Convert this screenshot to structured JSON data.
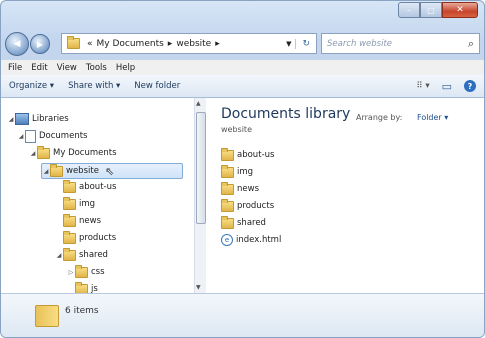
{
  "window": {
    "controls": {
      "minimize": "–",
      "maximize": "□",
      "close": "✕"
    }
  },
  "nav": {
    "back_icon": "◀",
    "forward_icon": "▶",
    "breadcrumb": [
      "«",
      "My Documents",
      "▸",
      "website",
      "▸"
    ],
    "refresh_icon": "↻",
    "search_placeholder": "Search website",
    "search_icon": "⌕"
  },
  "menu": [
    "File",
    "Edit",
    "View",
    "Tools",
    "Help"
  ],
  "commands": {
    "organize": "Organize ▾",
    "share": "Share with ▾",
    "new_folder": "New folder",
    "view_icon": "⠿ ▾",
    "preview_icon": "▭",
    "help_icon": "?"
  },
  "tree": [
    {
      "label": "Libraries",
      "indent": 0,
      "arrow": "◢",
      "icon": "library"
    },
    {
      "label": "Documents",
      "indent": 1,
      "arrow": "◢",
      "icon": "doc"
    },
    {
      "label": "My Documents",
      "indent": 2,
      "arrow": "◢",
      "icon": "folder"
    },
    {
      "label": "website",
      "indent": 3,
      "arrow": "◢",
      "icon": "folder",
      "selected": true
    },
    {
      "label": "about-us",
      "indent": 4,
      "arrow": "",
      "icon": "folder"
    },
    {
      "label": "img",
      "indent": 4,
      "arrow": "",
      "icon": "folder"
    },
    {
      "label": "news",
      "indent": 4,
      "arrow": "",
      "icon": "folder"
    },
    {
      "label": "products",
      "indent": 4,
      "arrow": "",
      "icon": "folder"
    },
    {
      "label": "shared",
      "indent": 4,
      "arrow": "◢",
      "icon": "folder"
    },
    {
      "label": "css",
      "indent": 5,
      "arrow": "▷",
      "icon": "folder"
    },
    {
      "label": "js",
      "indent": 5,
      "arrow": "",
      "icon": "folder"
    }
  ],
  "library": {
    "title": "Documents library",
    "subtitle": "website",
    "arrange_label": "Arrange by:",
    "arrange_value": "Folder ▾"
  },
  "files": [
    {
      "name": "about-us",
      "type": "folder"
    },
    {
      "name": "img",
      "type": "folder"
    },
    {
      "name": "news",
      "type": "folder"
    },
    {
      "name": "products",
      "type": "folder"
    },
    {
      "name": "shared",
      "type": "folder"
    },
    {
      "name": "index.html",
      "type": "html"
    }
  ],
  "status": {
    "count": "6 items"
  },
  "colors": {
    "accent": "#1e395b",
    "selection": "#cfe3f8"
  }
}
